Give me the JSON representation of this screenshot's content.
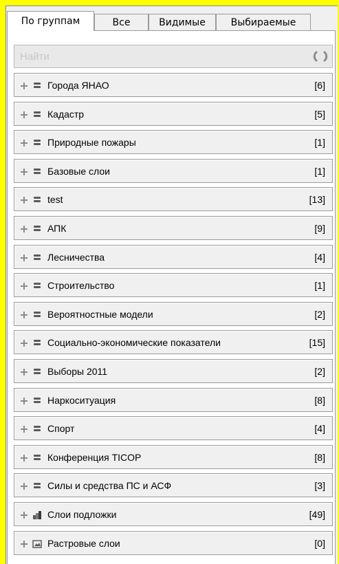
{
  "tabs": [
    {
      "label": "По группам",
      "active": true
    },
    {
      "label": "Все",
      "active": false
    },
    {
      "label": "Видимые",
      "active": false
    },
    {
      "label": "Выбираемые",
      "active": false
    }
  ],
  "search": {
    "placeholder": "Найти"
  },
  "groups": [
    {
      "label": "Города ЯНАО",
      "count": "[6]",
      "icon": "layers-icon"
    },
    {
      "label": "Кадастр",
      "count": "[5]",
      "icon": "layers-icon"
    },
    {
      "label": "Природные пожары",
      "count": "[1]",
      "icon": "layers-icon"
    },
    {
      "label": "Базовые слои",
      "count": "[1]",
      "icon": "layers-icon"
    },
    {
      "label": "test",
      "count": "[13]",
      "icon": "layers-icon"
    },
    {
      "label": "АПК",
      "count": "[9]",
      "icon": "layers-icon"
    },
    {
      "label": "Лесничества",
      "count": "[4]",
      "icon": "layers-icon"
    },
    {
      "label": "Строительство",
      "count": "[1]",
      "icon": "layers-icon"
    },
    {
      "label": "Вероятностные модели",
      "count": "[2]",
      "icon": "layers-icon"
    },
    {
      "label": "Социально-экономические показатели",
      "count": "[15]",
      "icon": "layers-icon"
    },
    {
      "label": "Выборы 2011",
      "count": "[2]",
      "icon": "layers-icon"
    },
    {
      "label": "Наркоситуация",
      "count": "[8]",
      "icon": "layers-icon"
    },
    {
      "label": "Спорт",
      "count": "[4]",
      "icon": "layers-icon"
    },
    {
      "label": "Конференция TICOP",
      "count": "[8]",
      "icon": "layers-icon"
    },
    {
      "label": "Силы и средства ПС и АСФ",
      "count": "[3]",
      "icon": "layers-icon"
    },
    {
      "label": "Слои подложки",
      "count": "[49]",
      "icon": "basemap-icon"
    },
    {
      "label": "Растровые слои",
      "count": "[0]",
      "icon": "raster-icon"
    }
  ]
}
